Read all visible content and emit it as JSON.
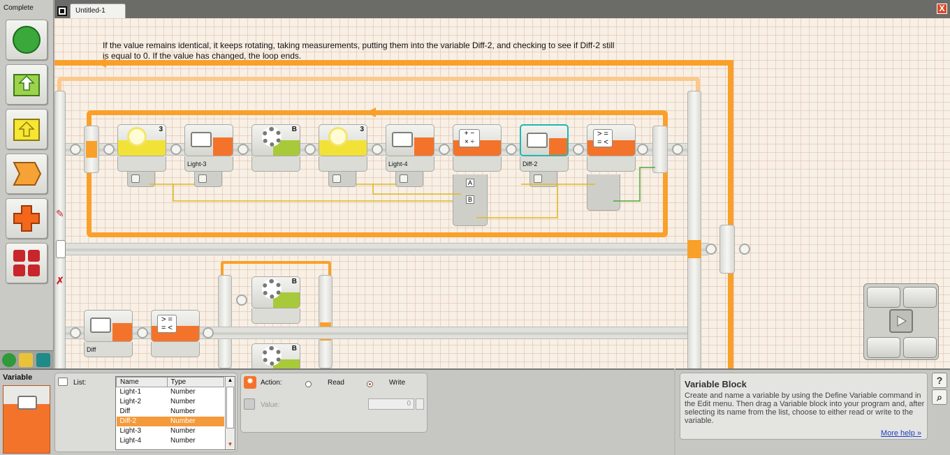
{
  "palette": {
    "title": "Complete",
    "icons": [
      "common-start-icon",
      "action-icon",
      "sensor-icon",
      "flow-icon",
      "data-icon",
      "advanced-icon"
    ]
  },
  "window": {
    "tab_label": "Untitled-1",
    "close_glyph": "X"
  },
  "canvas": {
    "comment": "If the value remains identical, it keeps rotating, taking measurements, putting them into the variable Diff-2, and checking to see if Diff-2 still is equal to 0. If the value has changed, the loop ends.",
    "blocks": [
      {
        "kind": "light-sensor",
        "port": "3"
      },
      {
        "kind": "variable",
        "label": "Light-3"
      },
      {
        "kind": "motor",
        "port": "B"
      },
      {
        "kind": "light-sensor",
        "port": "3"
      },
      {
        "kind": "variable",
        "label": "Light-4"
      },
      {
        "kind": "math"
      },
      {
        "kind": "variable",
        "label": "Diff-2",
        "selected": true
      },
      {
        "kind": "compare"
      },
      {
        "kind": "variable",
        "label": "Diff"
      },
      {
        "kind": "compare"
      },
      {
        "kind": "motor",
        "port": "B"
      },
      {
        "kind": "motor",
        "port": "B"
      }
    ],
    "plug_labels": {
      "a": "A",
      "b": "B"
    }
  },
  "config": {
    "title": "Variable",
    "list_label": "List:",
    "columns": [
      "Name",
      "Type"
    ],
    "rows": [
      {
        "name": "Light-1",
        "type": "Number"
      },
      {
        "name": "Light-2",
        "type": "Number"
      },
      {
        "name": "Diff",
        "type": "Number"
      },
      {
        "name": "Diff-2",
        "type": "Number",
        "selected": true
      },
      {
        "name": "Light-3",
        "type": "Number"
      },
      {
        "name": "Light-4",
        "type": "Number"
      }
    ],
    "action_label": "Action:",
    "read_label": "Read",
    "write_label": "Write",
    "selected_action": "Write",
    "value_label": "Value:",
    "value": "0"
  },
  "help": {
    "title": "Variable Block",
    "body": "Create and name a variable by using the Define Variable command in the Edit menu. Then drag a Variable block into your program and, after selecting its name from the list, choose to either read or write to the variable.",
    "link": "More help »",
    "help_glyph": "?",
    "zoom_glyph": "⌕"
  },
  "colors": {
    "orange": "#f9a02a",
    "variable_orange": "#f4732a",
    "sensor_yellow": "#f2e238",
    "motor_green": "#a8c93a",
    "selection": "#22b6b6"
  }
}
